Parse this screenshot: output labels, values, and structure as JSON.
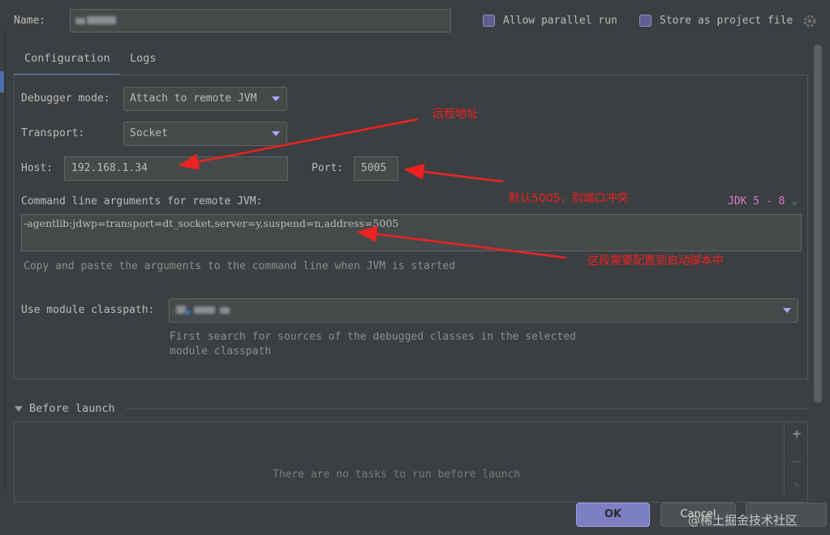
{
  "header": {
    "name_label": "Name:",
    "allow_parallel_label": "Allow parallel run",
    "store_project_label": "Store as project file",
    "gear_icon": "gear-icon"
  },
  "tabs": [
    {
      "label": "Configuration",
      "active": true
    },
    {
      "label": "Logs",
      "active": false
    }
  ],
  "config": {
    "debugger_mode_label": "Debugger mode:",
    "debugger_mode_value": "Attach to remote JVM",
    "transport_label": "Transport:",
    "transport_value": "Socket",
    "host_label": "Host:",
    "host_value": "192.168.1.34",
    "port_label": "Port:",
    "port_value": "5005",
    "cmd_label": "Command line arguments for remote JVM:",
    "jdk_label": "JDK 5 - 8",
    "cmd_value": "-agentlib:jdwp=transport=dt_socket,server=y,suspend=n,address=5005",
    "cmd_hint": "Copy and paste the arguments to the command line when JVM is started",
    "module_label": "Use module classpath:",
    "module_hint_1": "First search for sources of the debugged classes in the selected",
    "module_hint_2": "module classpath"
  },
  "annotations": {
    "remote_address": "远程地址",
    "default_port": "默认5005，别端口冲突",
    "startup_script": "这段需要配置到启动脚本中"
  },
  "before_launch": {
    "title": "Before launch",
    "empty_message": "There are no tasks to run before launch"
  },
  "buttons": {
    "ok": "OK",
    "cancel": "Cancel"
  },
  "watermark": "@稀土掘金技术社区",
  "colors": {
    "background": "#3c3f41",
    "accent": "#4a88c7",
    "annotation": "#ee2222",
    "ok_button": "#7c7fc2",
    "jdk": "#d97ac5"
  }
}
